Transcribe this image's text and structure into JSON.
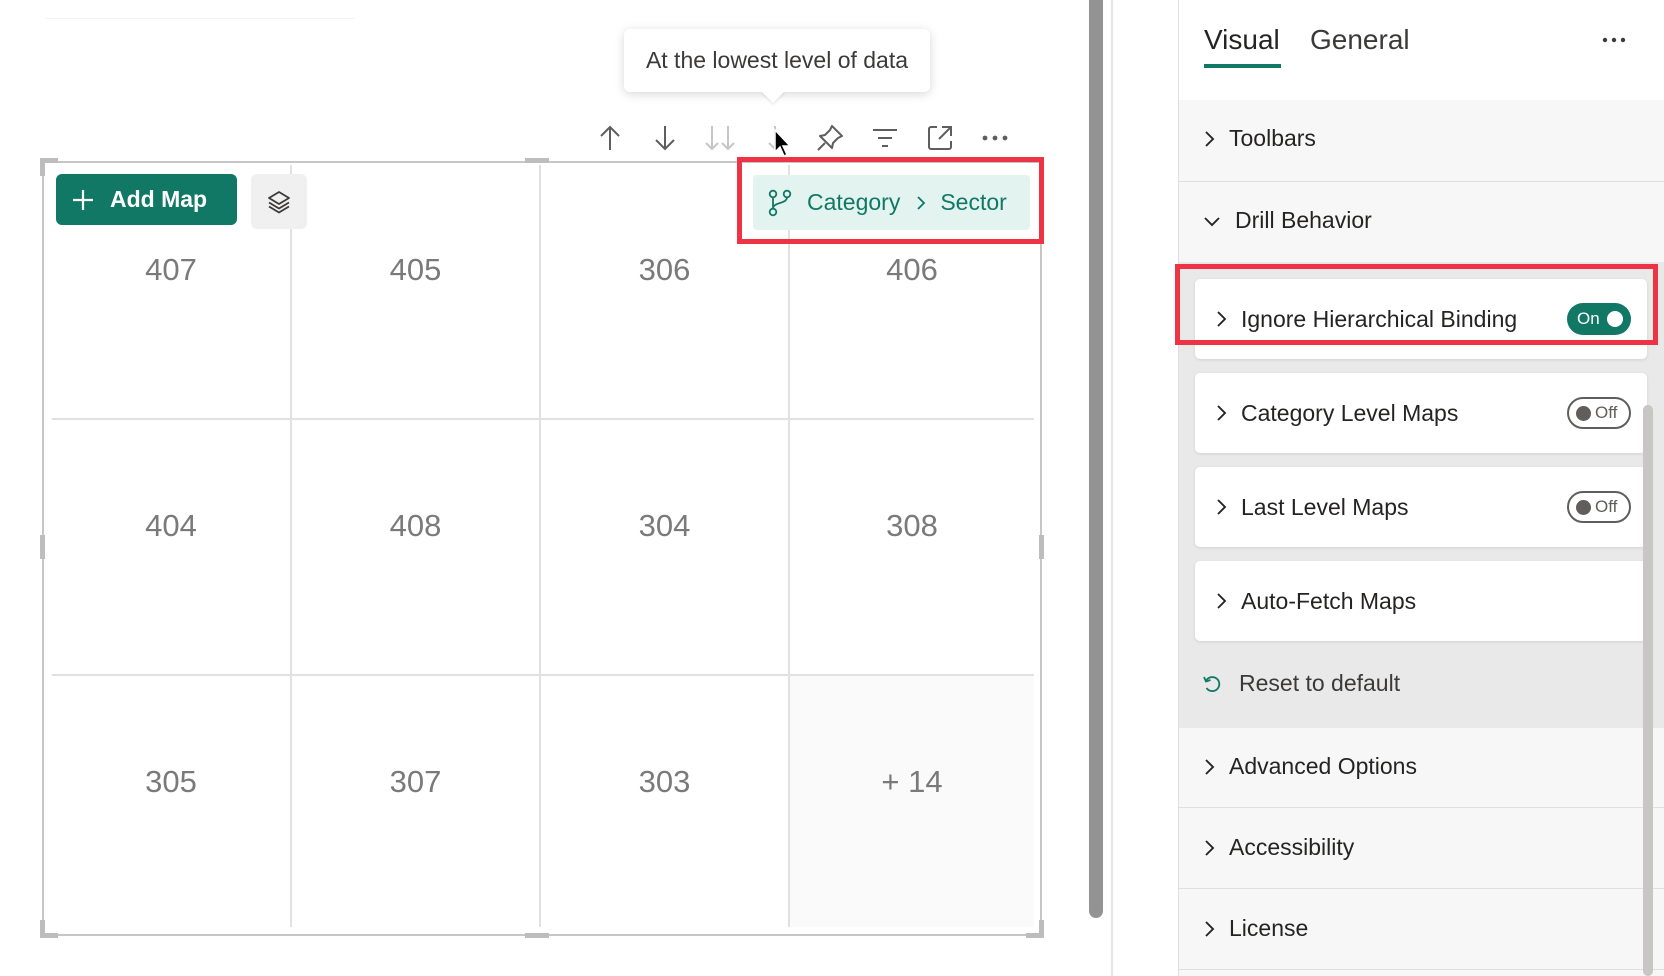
{
  "tooltip": {
    "text": "At the lowest level of data"
  },
  "visual": {
    "add_map_label": "Add Map",
    "breadcrumb": {
      "level1": "Category",
      "level2": "Sector"
    },
    "grid_cells": [
      "407",
      "405",
      "306",
      "406",
      "404",
      "408",
      "304",
      "308",
      "305",
      "307",
      "303",
      "+ 14"
    ]
  },
  "format_pane": {
    "tabs": {
      "visual": "Visual",
      "general": "General"
    },
    "sections": {
      "toolbars": "Toolbars",
      "drill_behavior": "Drill Behavior",
      "advanced_options": "Advanced Options",
      "accessibility": "Accessibility",
      "license": "License"
    },
    "drill_cards": {
      "ignore_hierarchical_binding": {
        "label": "Ignore Hierarchical Binding",
        "toggle": "On"
      },
      "category_level_maps": {
        "label": "Category Level Maps",
        "toggle": "Off"
      },
      "last_level_maps": {
        "label": "Last Level Maps",
        "toggle": "Off"
      },
      "auto_fetch_maps": {
        "label": "Auto-Fetch Maps"
      }
    },
    "reset_label": "Reset to default"
  },
  "colors": {
    "accent": "#117865",
    "highlight_box": "#ee3344",
    "breadcrumb_bg": "#e3f4f0"
  }
}
